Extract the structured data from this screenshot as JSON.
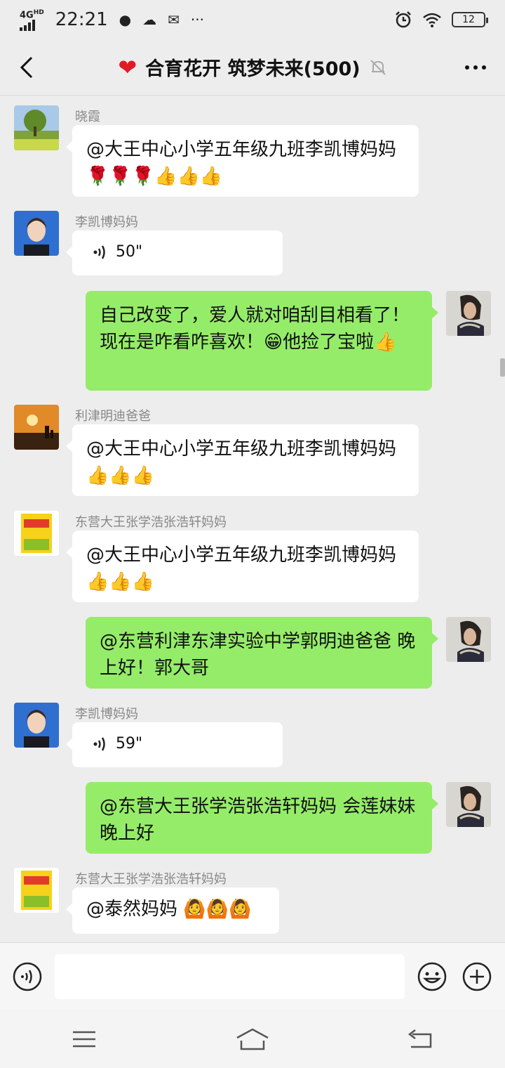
{
  "status": {
    "network": "4G",
    "network_sup": "HD",
    "time": "22:21",
    "battery": "12"
  },
  "header": {
    "title": "合育花开 筑梦未来(500)"
  },
  "messages": [
    {
      "side": "left",
      "sender": "晓霞",
      "text": "@大王中心小学五年级九班李凯博妈妈 🌹🌹🌹👍👍👍"
    },
    {
      "side": "left",
      "sender": "李凯博妈妈",
      "voice_duration": "50\""
    },
    {
      "side": "right",
      "text": "自己改变了，爱人就对咱刮目相看了！现在是咋看咋喜欢！😁他捡了宝啦👍"
    },
    {
      "side": "left",
      "sender": "利津明迪爸爸",
      "text": "@大王中心小学五年级九班李凯博妈妈 👍👍👍"
    },
    {
      "side": "left",
      "sender": "东营大王张学浩张浩轩妈妈",
      "text": "@大王中心小学五年级九班李凯博妈妈 👍👍👍"
    },
    {
      "side": "right",
      "text": "@东营利津东津实验中学郭明迪爸爸 晚上好！郭大哥"
    },
    {
      "side": "left",
      "sender": "李凯博妈妈",
      "voice_duration": "59\""
    },
    {
      "side": "right",
      "text": "@东营大王张学浩张浩轩妈妈  会莲妹妹晚上好"
    },
    {
      "side": "left",
      "sender": "东营大王张学浩张浩轩妈妈",
      "text": "@泰然妈妈 🙆🙆🙆"
    }
  ],
  "icons": {
    "back": "back-arrow-icon",
    "more": "more-dots-icon",
    "mute": "bell-muted-icon",
    "voice": "voice-input-icon",
    "emoji": "emoji-icon",
    "plus": "plus-icon"
  }
}
